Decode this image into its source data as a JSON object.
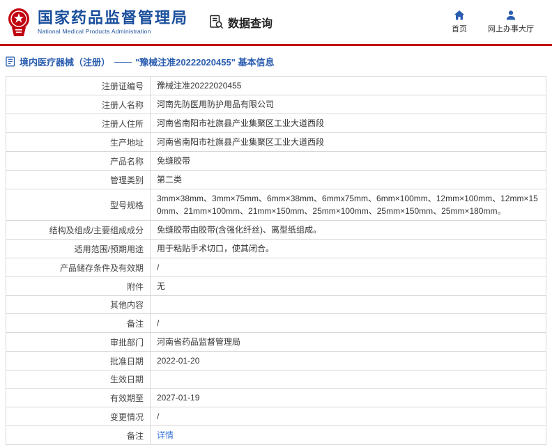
{
  "header": {
    "agency_cn": "国家药品监督管理局",
    "agency_en": "National Medical Products Administration",
    "data_query": "数据查询",
    "nav": [
      {
        "label": "首页",
        "icon": "home-icon"
      },
      {
        "label": "网上办事大厅",
        "icon": "person-icon"
      }
    ]
  },
  "breadcrumb": {
    "section": "境内医疗器械（注册）",
    "dash": "——",
    "title": "\"豫械注准20222020455\" 基本信息"
  },
  "colors": {
    "brand_blue": "#1a4f9c",
    "accent_red": "#c1000f",
    "link_blue": "#3573d9"
  },
  "table": {
    "rows": [
      {
        "label": "注册证编号",
        "value": "豫械注准20222020455"
      },
      {
        "label": "注册人名称",
        "value": "河南先防医用防护用品有限公司"
      },
      {
        "label": "注册人住所",
        "value": "河南省南阳市社旗县产业集聚区工业大道西段"
      },
      {
        "label": "生产地址",
        "value": "河南省南阳市社旗县产业集聚区工业大道西段"
      },
      {
        "label": "产品名称",
        "value": "免缝胶带"
      },
      {
        "label": "管理类别",
        "value": "第二类"
      },
      {
        "label": "型号规格",
        "value": "3mm×38mm、3mm×75mm、6mm×38mm、6mmx75mm、6mm×100mm、12mm×100mm、12mm×150mm、21mm×100mm、21mm×150mm、25mm×100mm、25mm×150mm、25mm×180mm。"
      },
      {
        "label": "结构及组成/主要组成成分",
        "value": "免缝胶带由胶带(含强化纤丝)、离型纸组成。"
      },
      {
        "label": "适用范围/预期用途",
        "value": "用于粘贴手术切口，使其闭合。"
      },
      {
        "label": "产品储存条件及有效期",
        "value": "/"
      },
      {
        "label": "附件",
        "value": "无"
      },
      {
        "label": "其他内容",
        "value": ""
      },
      {
        "label": "备注",
        "value": "/"
      },
      {
        "label": "审批部门",
        "value": "河南省药品监督管理局"
      },
      {
        "label": "批准日期",
        "value": "2022-01-20"
      },
      {
        "label": "生效日期",
        "value": ""
      },
      {
        "label": "有效期至",
        "value": "2027-01-19"
      },
      {
        "label": "变更情况",
        "value": "/"
      },
      {
        "label": "备注",
        "value": "详情",
        "link": true
      }
    ]
  }
}
